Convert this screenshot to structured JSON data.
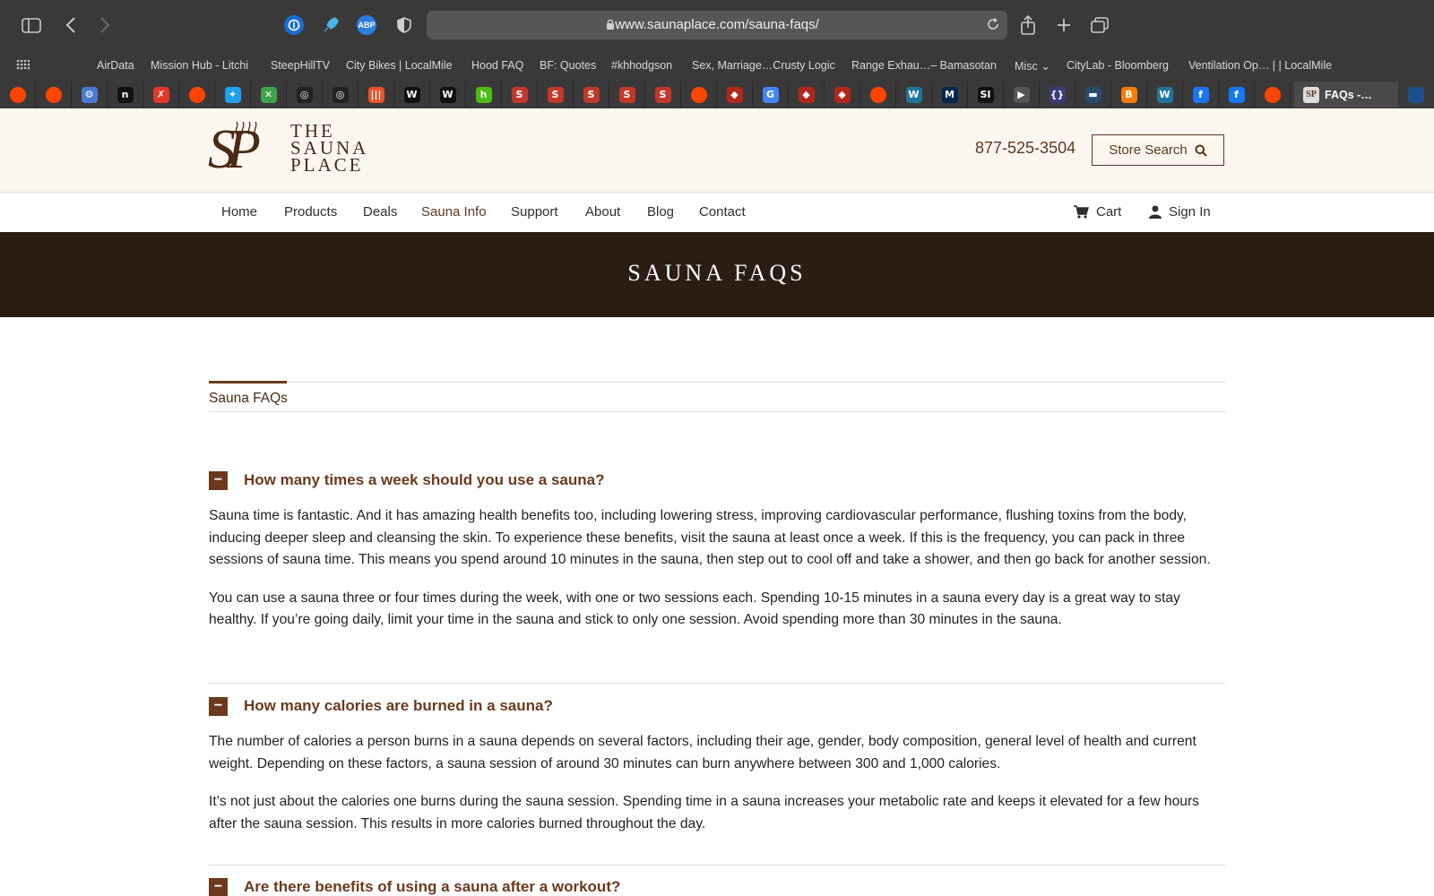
{
  "browser": {
    "url": "www.saunaplace.com/sauna-faqs/",
    "favorites": [
      "AirData",
      "Mission Hub - Litchi",
      "SteepHillTV",
      "City Bikes | LocalMile",
      "Hood FAQ",
      "BF: Quotes",
      "#khhodgson",
      "Sex, Marriage…Crusty Logic",
      "Range Exhau…– Bamasotan",
      "Misc",
      "CityLab - Bloomberg",
      "Ventilation Op… | | LocalMile"
    ],
    "active_tab_title": "FAQs -…",
    "pinned_tabs": [
      {
        "icon": "reddit-icon",
        "glyph": "●",
        "color": "#ff4500"
      },
      {
        "icon": "reddit-icon",
        "glyph": "●",
        "color": "#ff4500"
      },
      {
        "icon": "settings-app-icon",
        "glyph": "⚙",
        "color": "#4a7bd0"
      },
      {
        "icon": "notion-icon",
        "glyph": "n",
        "color": "#111111"
      },
      {
        "icon": "runner-icon",
        "glyph": "✗",
        "color": "#e03a2a"
      },
      {
        "icon": "reddit-icon",
        "glyph": "●",
        "color": "#ff4500"
      },
      {
        "icon": "twitter-icon",
        "glyph": "✦",
        "color": "#1da1f2"
      },
      {
        "icon": "map-icon",
        "glyph": "✕",
        "color": "#3fa34d"
      },
      {
        "icon": "instagram-icon",
        "glyph": "◎",
        "color": "#222222"
      },
      {
        "icon": "instagram-icon",
        "glyph": "◎",
        "color": "#222222"
      },
      {
        "icon": "chart-icon",
        "glyph": "|||",
        "color": "#e8542a"
      },
      {
        "icon": "wikipedia-icon",
        "glyph": "W",
        "color": "#111111"
      },
      {
        "icon": "wikipedia-icon",
        "glyph": "W",
        "color": "#111111"
      },
      {
        "icon": "houzz-icon",
        "glyph": "h",
        "color": "#4dbc15"
      },
      {
        "icon": "sauna-s-icon",
        "glyph": "S",
        "color": "#c0392b"
      },
      {
        "icon": "sauna-s-icon",
        "glyph": "S",
        "color": "#c0392b"
      },
      {
        "icon": "sauna-s-icon",
        "glyph": "S",
        "color": "#c0392b"
      },
      {
        "icon": "sauna-s-icon",
        "glyph": "S",
        "color": "#c0392b"
      },
      {
        "icon": "sauna-s-icon",
        "glyph": "S",
        "color": "#c0392b"
      },
      {
        "icon": "reddit-icon",
        "glyph": "●",
        "color": "#ff4500"
      },
      {
        "icon": "flame-icon",
        "glyph": "◆",
        "color": "#b0281c"
      },
      {
        "icon": "translate-icon",
        "glyph": "G",
        "color": "#4285f4"
      },
      {
        "icon": "flame-icon",
        "glyph": "◆",
        "color": "#b0281c"
      },
      {
        "icon": "flame-icon",
        "glyph": "◆",
        "color": "#b0281c"
      },
      {
        "icon": "reddit-icon",
        "glyph": "●",
        "color": "#ff4500"
      },
      {
        "icon": "wordpress-icon",
        "glyph": "W",
        "color": "#21759b"
      },
      {
        "icon": "michigan-icon",
        "glyph": "M",
        "color": "#00274c"
      },
      {
        "icon": "si-icon",
        "glyph": "SI",
        "color": "#111111"
      },
      {
        "icon": "arrow-tab-icon",
        "glyph": "▶",
        "color": "#555555"
      },
      {
        "icon": "code-braces-icon",
        "glyph": "{}",
        "color": "#3a3a7a"
      },
      {
        "icon": "keyboard-icon",
        "glyph": "▬",
        "color": "#2a4a6a"
      },
      {
        "icon": "blogger-icon",
        "glyph": "B",
        "color": "#f57d00"
      },
      {
        "icon": "wordpress-icon",
        "glyph": "W",
        "color": "#21759b"
      },
      {
        "icon": "facebook-icon",
        "glyph": "f",
        "color": "#1877f2"
      },
      {
        "icon": "facebook-icon",
        "glyph": "f",
        "color": "#1877f2"
      },
      {
        "icon": "reddit-icon",
        "glyph": "●",
        "color": "#ff4500"
      }
    ]
  },
  "site": {
    "brand_line1": "THE",
    "brand_line2": "SAUNA",
    "brand_line3": "PLACE",
    "phone": "877-525-3504",
    "store_search": "Store Search",
    "nav": [
      "Home",
      "Products",
      "Deals",
      "Sauna Info",
      "Support",
      "About",
      "Blog",
      "Contact"
    ],
    "active_nav": "Sauna Info",
    "cart": "Cart",
    "sign_in": "Sign In",
    "accent_color": "#6b3a1e",
    "hero_bg": "#2c1d12"
  },
  "page": {
    "title": "SAUNA FAQS",
    "tab": "Sauna FAQs",
    "faqs": [
      {
        "question": "How many times a week should you use a sauna?",
        "answer": [
          "Sauna time is fantastic. And it has amazing health benefits too, including lowering stress, improving cardiovascular performance, flushing toxins from the body, inducing deeper sleep and cleansing the skin. To experience these benefits, visit the sauna at least once a week. If this is the frequency, you can pack in three sessions of sauna time. This means you spend around 10 minutes in the sauna, then step out to cool off and take a shower, and then go back for another session.",
          "You can use a sauna three or four times during the week, with one or two sessions each. Spending 10-15 minutes in a sauna every day is a great way to stay healthy. If you’re going daily, limit your time in the sauna and stick to only one session. Avoid spending more than 30 minutes in the sauna."
        ]
      },
      {
        "question": "How many calories are burned in a sauna?",
        "answer": [
          "The number of calories a person burns in a sauna depends on several factors, including their age, gender, body composition, general level of health and current weight. Depending on these factors, a sauna session of around 30 minutes can burn anywhere between 300 and 1,000 calories.",
          "It’s not just about the calories one burns during the sauna session. Spending time in a sauna increases your metabolic rate and keeps it elevated for a few hours after the sauna session. This results in more calories burned throughout the day."
        ]
      },
      {
        "question": "Are there benefits of using a sauna after a workout?",
        "answer": []
      }
    ],
    "toggle_symbol": "−"
  }
}
